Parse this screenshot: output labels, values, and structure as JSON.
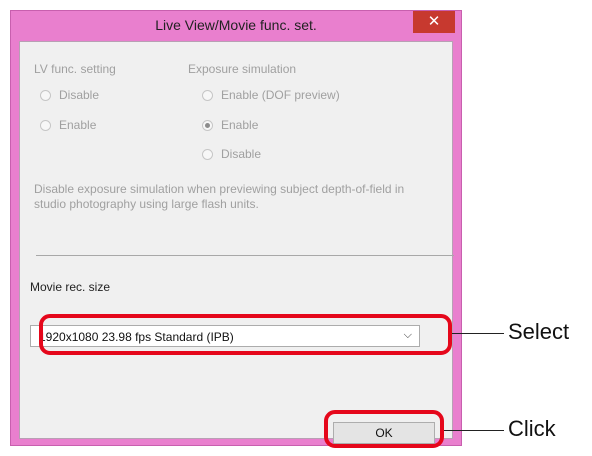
{
  "window": {
    "title": "Live View/Movie func. set.",
    "close_glyph": "✕"
  },
  "lv_func": {
    "heading": "LV func. setting",
    "options": [
      {
        "label": "Disable",
        "selected": false
      },
      {
        "label": "Enable",
        "selected": false
      }
    ]
  },
  "exposure_sim": {
    "heading": "Exposure simulation",
    "options": [
      {
        "label": "Enable (DOF preview)",
        "selected": false
      },
      {
        "label": "Enable",
        "selected": true
      },
      {
        "label": "Disable",
        "selected": false
      }
    ]
  },
  "description": "Disable exposure simulation when previewing subject depth-of-field in studio photography using large flash units.",
  "movie_rec": {
    "label": "Movie rec. size",
    "selected_value": "1920x1080  23.98 fps Standard (IPB)"
  },
  "buttons": {
    "ok": "OK"
  },
  "annotations": {
    "select_label": "Select",
    "click_label": "Click",
    "highlight_color": "#e5071b"
  },
  "colors": {
    "window_frame": "#e97fce",
    "close_button": "#c7392f"
  }
}
